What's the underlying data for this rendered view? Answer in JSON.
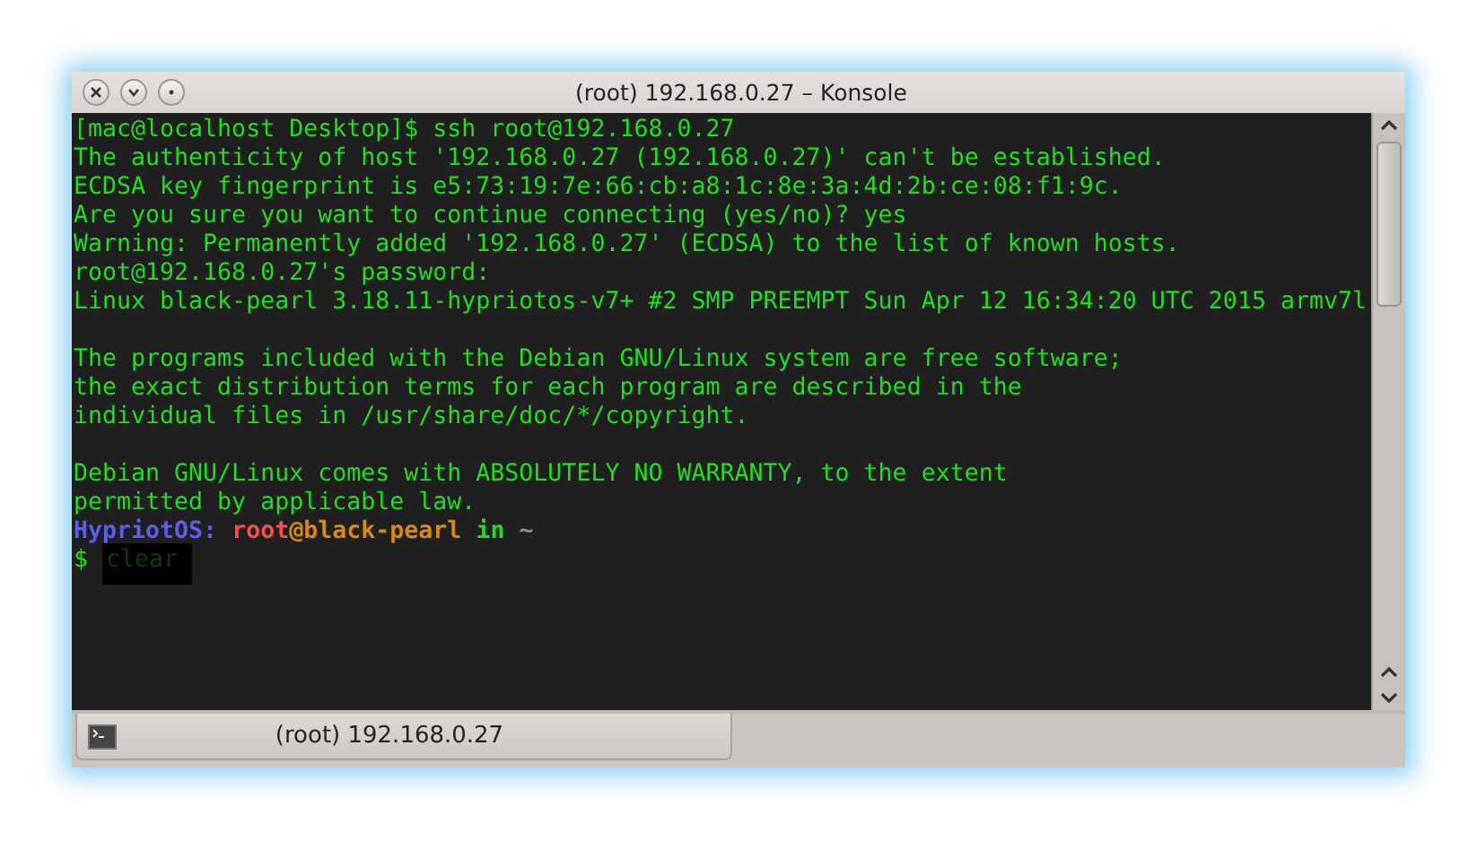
{
  "window": {
    "title": "(root) 192.168.0.27 – Konsole"
  },
  "terminal": {
    "lines": [
      {
        "kind": "text",
        "text": "[mac@localhost Desktop]$ ssh root@192.168.0.27"
      },
      {
        "kind": "text",
        "text": "The authenticity of host '192.168.0.27 (192.168.0.27)' can't be established."
      },
      {
        "kind": "text",
        "text": "ECDSA key fingerprint is e5:73:19:7e:66:cb:a8:1c:8e:3a:4d:2b:ce:08:f1:9c."
      },
      {
        "kind": "text",
        "text": "Are you sure you want to continue connecting (yes/no)? yes"
      },
      {
        "kind": "text",
        "text": "Warning: Permanently added '192.168.0.27' (ECDSA) to the list of known hosts."
      },
      {
        "kind": "text",
        "text": "root@192.168.0.27's password:"
      },
      {
        "kind": "text",
        "text": "Linux black-pearl 3.18.11-hypriotos-v7+ #2 SMP PREEMPT Sun Apr 12 16:34:20 UTC 2015 armv7l"
      },
      {
        "kind": "blank"
      },
      {
        "kind": "text",
        "text": "The programs included with the Debian GNU/Linux system are free software;"
      },
      {
        "kind": "text",
        "text": "the exact distribution terms for each program are described in the"
      },
      {
        "kind": "text",
        "text": "individual files in /usr/share/doc/*/copyright."
      },
      {
        "kind": "blank"
      },
      {
        "kind": "text",
        "text": "Debian GNU/Linux comes with ABSOLUTELY NO WARRANTY, to the extent"
      },
      {
        "kind": "text",
        "text": "permitted by applicable law."
      },
      {
        "kind": "prompt",
        "segments": [
          {
            "text": "HypriotOS:",
            "color": "#5c5cf0",
            "bold": true
          },
          {
            "text": "root",
            "color": "#f05050",
            "bold": true
          },
          {
            "text": "@black-pearl",
            "color": "#d88a10",
            "bold": true
          },
          {
            "text": "in",
            "color": "#22dd22",
            "bold": true
          },
          {
            "text": "~",
            "color": "#909090",
            "bold": true
          }
        ]
      },
      {
        "kind": "input",
        "prompt": "$",
        "command": "clear",
        "selected": true
      }
    ]
  },
  "tabs": [
    {
      "label": "(root) 192.168.0.27",
      "selected": true
    }
  ]
}
